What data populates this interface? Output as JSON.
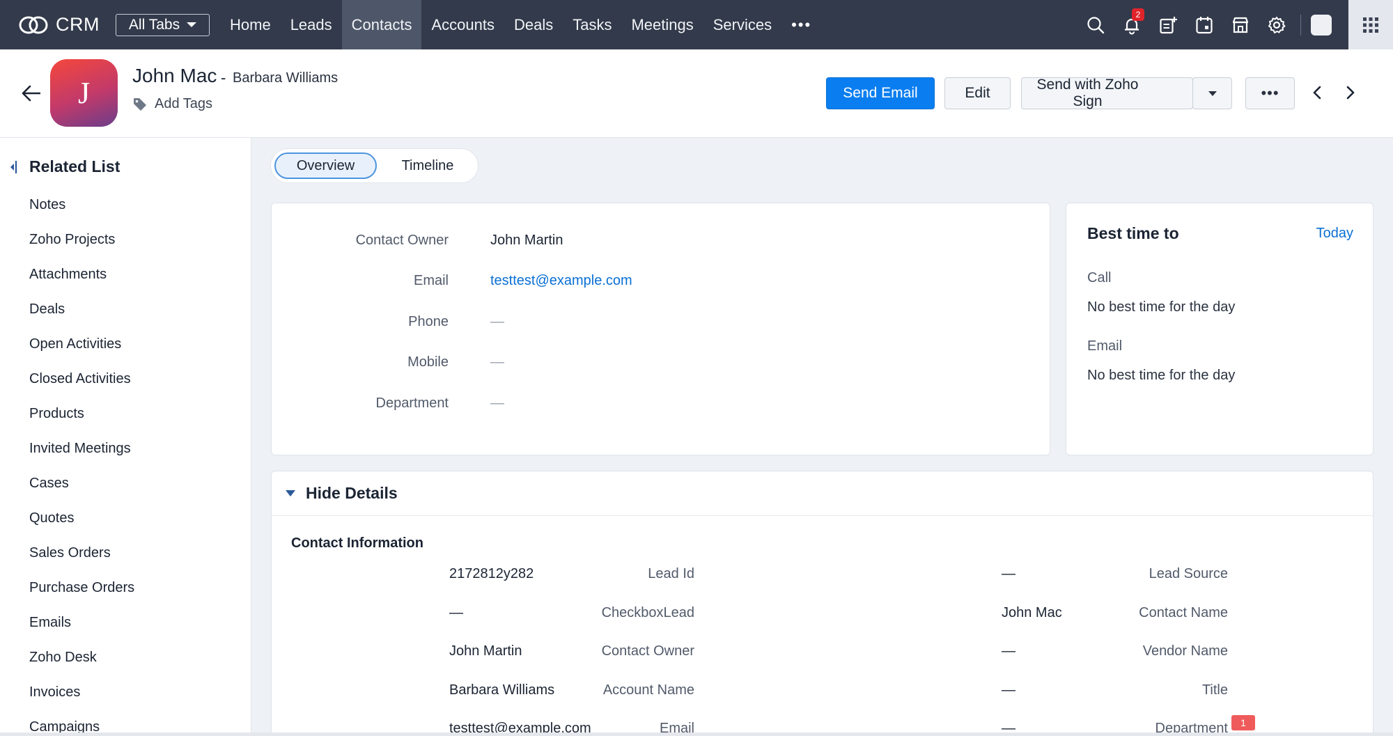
{
  "app": {
    "name": "CRM"
  },
  "topnav": {
    "all_tabs_label": "All Tabs",
    "tabs": [
      "Home",
      "Leads",
      "Contacts",
      "Accounts",
      "Deals",
      "Tasks",
      "Meetings",
      "Services"
    ],
    "active_tab": "Contacts",
    "more_label": "•••",
    "notification_count": "2",
    "icons": [
      "search-icon",
      "bell-icon",
      "add-record-icon",
      "calendar-icon",
      "marketplace-icon",
      "gear-icon",
      "profile-avatar",
      "app-grid-icon"
    ]
  },
  "record": {
    "avatar_initial": "J",
    "name": "John Mac",
    "separator": "-",
    "account": "Barbara Williams",
    "add_tags": "Add Tags"
  },
  "actions": {
    "send_email": "Send Email",
    "edit": "Edit",
    "send_zoho_sign": "Send with Zoho Sign",
    "more": "•••"
  },
  "sidebar": {
    "title": "Related List",
    "items": [
      "Notes",
      "Zoho Projects",
      "Attachments",
      "Deals",
      "Open Activities",
      "Closed Activities",
      "Products",
      "Invited Meetings",
      "Cases",
      "Quotes",
      "Sales Orders",
      "Purchase Orders",
      "Emails",
      "Zoho Desk",
      "Invoices",
      "Campaigns"
    ]
  },
  "view_tabs": {
    "overview": "Overview",
    "timeline": "Timeline",
    "active": "Overview"
  },
  "overview": {
    "fields": [
      {
        "label": "Contact Owner",
        "value": "John Martin"
      },
      {
        "label": "Email",
        "value": "testtest@example.com"
      },
      {
        "label": "Phone",
        "value": "—"
      },
      {
        "label": "Mobile",
        "value": "—"
      },
      {
        "label": "Department",
        "value": "—"
      }
    ]
  },
  "best_time": {
    "title": "Best time to",
    "today": "Today",
    "call_label": "Call",
    "call_value": "No best time for the day",
    "email_label": "Email",
    "email_value": "No best time for the day"
  },
  "details": {
    "toggle_label": "Hide Details",
    "section_title": "Contact Information",
    "left": [
      {
        "label": "Lead Id",
        "value": "2172812y282"
      },
      {
        "label": "CheckboxLead",
        "value": "—"
      },
      {
        "label": "Contact Owner",
        "value": "John Martin"
      },
      {
        "label": "Account Name",
        "value": "Barbara Williams"
      },
      {
        "label": "Email",
        "value": "testtest@example.com"
      }
    ],
    "right": [
      {
        "label": "Lead Source",
        "value": "—"
      },
      {
        "label": "Contact Name",
        "value": "John Mac"
      },
      {
        "label": "Vendor Name",
        "value": "—"
      },
      {
        "label": "Title",
        "value": "—"
      },
      {
        "label": "Department",
        "value": "—"
      }
    ]
  },
  "floating_badge": "1",
  "colors": {
    "nav_bg": "#323a4b",
    "nav_active": "#4e5769",
    "primary": "#0a7ef0",
    "link": "#0a6fd4",
    "badge": "#e0242b"
  }
}
